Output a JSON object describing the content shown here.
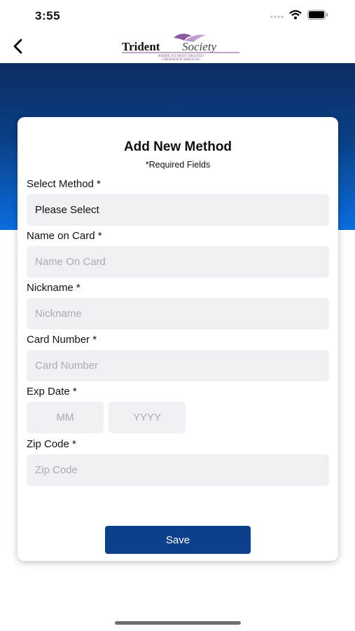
{
  "status": {
    "time": "3:55"
  },
  "logo": {
    "brand_text": "Trident Society",
    "tagline": "AMERICA'S MOST TRUSTED CREMATION SERVICES"
  },
  "form": {
    "title": "Add New Method",
    "required_note": "*Required Fields",
    "select_method_label": "Select Method *",
    "select_method_value": "Please Select",
    "name_label": "Name on Card *",
    "name_placeholder": "Name On Card",
    "nickname_label": "Nickname *",
    "nickname_placeholder": "Nickname",
    "card_number_label": "Card Number *",
    "card_number_placeholder": "Card Number",
    "exp_label": "Exp Date *",
    "exp_month_placeholder": "MM",
    "exp_year_placeholder": "YYYY",
    "zip_label": "Zip Code *",
    "zip_placeholder": "Zip Code",
    "save_label": "Save"
  },
  "colors": {
    "header_top": "#0b2d63",
    "header_bottom": "#0a6ee0",
    "button": "#0c3f8c",
    "field_bg": "#eef0f3"
  }
}
